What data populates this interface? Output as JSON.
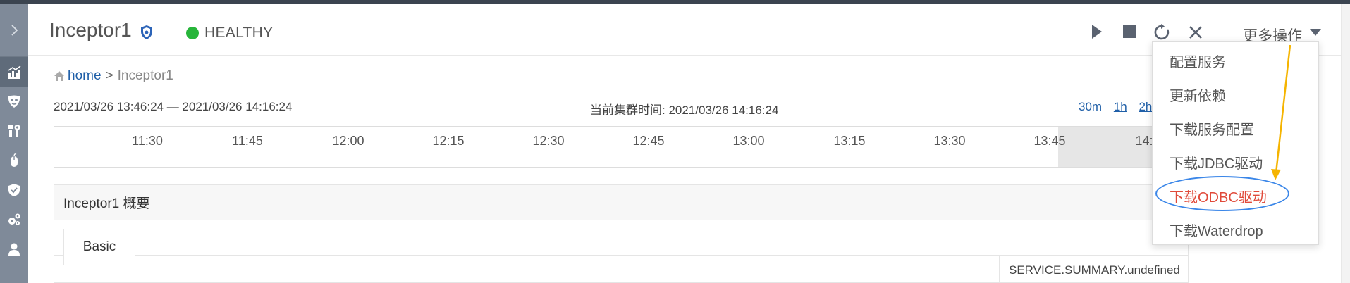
{
  "header": {
    "service_name": "Inceptor1",
    "status": "HEALTHY",
    "status_color": "#27b53a",
    "more_actions_label": "更多操作",
    "controls": [
      "play-icon",
      "stop-icon",
      "restart-icon",
      "close-icon"
    ]
  },
  "sidebar": {
    "items": [
      "chevron-right-icon",
      "dashboard-chart-icon",
      "mask-icon",
      "tools-icon",
      "mouse-icon",
      "shield-check-icon",
      "gears-icon",
      "user-icon"
    ]
  },
  "breadcrumb": {
    "home": "home",
    "separator": ">",
    "current": "Inceptor1"
  },
  "timebar": {
    "range": "2021/03/26 13:46:24 — 2021/03/26 14:16:24",
    "cluster_time": "当前集群时间: 2021/03/26 14:16:24",
    "buttons": [
      "30m",
      "1h",
      "2h"
    ]
  },
  "timeline": {
    "ticks": [
      "11:30",
      "11:45",
      "12:00",
      "12:15",
      "12:30",
      "12:45",
      "13:00",
      "13:15",
      "13:30",
      "13:45",
      "14:"
    ]
  },
  "panel": {
    "title": "Inceptor1 概要",
    "tab": "Basic",
    "summary": "SERVICE.SUMMARY.undefined"
  },
  "dropdown": {
    "items": [
      "配置服务",
      "更新依赖",
      "下载服务配置",
      "下载JDBC驱动",
      "下载ODBC驱动",
      "下载Waterdrop"
    ],
    "highlight_color": "#e04a3a",
    "annotation_arrow_color": "#f5b400",
    "annotation_ellipse_color": "#3a86e8"
  }
}
